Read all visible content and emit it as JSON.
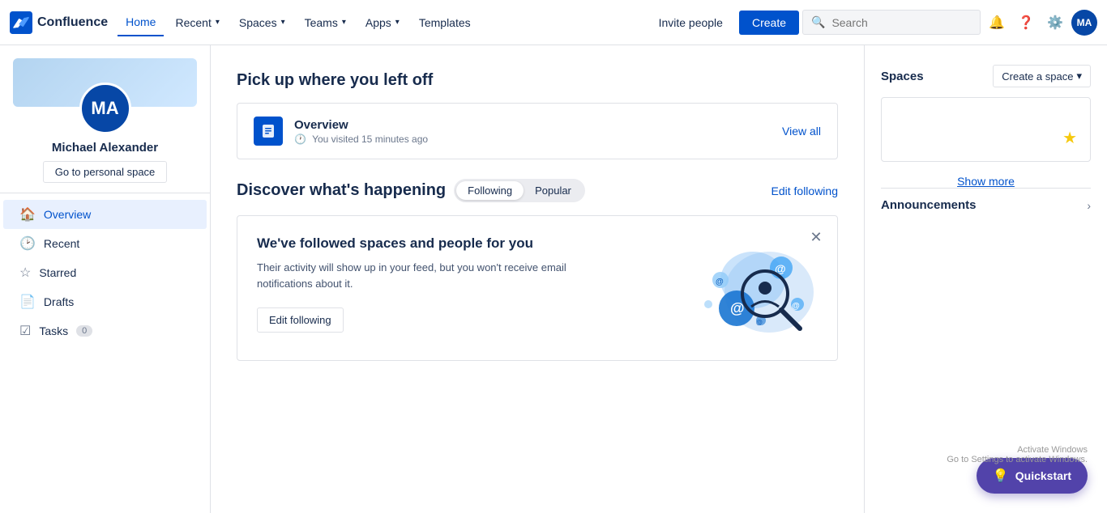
{
  "navbar": {
    "logo_text": "Confluence",
    "nav_items": [
      {
        "id": "home",
        "label": "Home",
        "active": true,
        "has_dropdown": false
      },
      {
        "id": "recent",
        "label": "Recent",
        "active": false,
        "has_dropdown": true
      },
      {
        "id": "spaces",
        "label": "Spaces",
        "active": false,
        "has_dropdown": true
      },
      {
        "id": "teams",
        "label": "Teams",
        "active": false,
        "has_dropdown": true
      },
      {
        "id": "apps",
        "label": "Apps",
        "active": false,
        "has_dropdown": true
      },
      {
        "id": "templates",
        "label": "Templates",
        "active": false,
        "has_dropdown": false
      }
    ],
    "invite_label": "Invite people",
    "create_label": "Create",
    "search_placeholder": "Search",
    "user_initials": "MA"
  },
  "sidebar": {
    "profile": {
      "initials": "MA",
      "name": "Michael Alexander",
      "personal_space_label": "Go to personal space"
    },
    "nav_items": [
      {
        "id": "overview",
        "label": "Overview",
        "icon": "🏠",
        "active": true,
        "badge": null
      },
      {
        "id": "recent",
        "label": "Recent",
        "icon": "🕑",
        "active": false,
        "badge": null
      },
      {
        "id": "starred",
        "label": "Starred",
        "icon": "☆",
        "active": false,
        "badge": null
      },
      {
        "id": "drafts",
        "label": "Drafts",
        "icon": "📄",
        "active": false,
        "badge": null
      },
      {
        "id": "tasks",
        "label": "Tasks",
        "icon": "☑",
        "active": false,
        "badge": "0"
      }
    ]
  },
  "main": {
    "pick_up_title": "Pick up where you left off",
    "pick_up_item": {
      "title": "Overview",
      "meta": "You visited 15 minutes ago"
    },
    "view_all_label": "View all",
    "discover_title": "Discover what's happening",
    "tabs": [
      {
        "id": "following",
        "label": "Following",
        "active": true
      },
      {
        "id": "popular",
        "label": "Popular",
        "active": false
      }
    ],
    "edit_following_label": "Edit following",
    "followed_card": {
      "title": "We've followed spaces and people for you",
      "description": "Their activity will show up in your feed, but you won't receive email notifications about it.",
      "edit_btn_label": "Edit following"
    }
  },
  "right_panel": {
    "spaces_title": "Spaces",
    "create_space_label": "Create a space",
    "show_more_label": "Show more",
    "announcements_title": "Announcements"
  },
  "quickstart": {
    "label": "Quickstart"
  },
  "activate_watermark": {
    "line1": "Activate Windows",
    "line2": "Go to Settings to activate Windows."
  }
}
